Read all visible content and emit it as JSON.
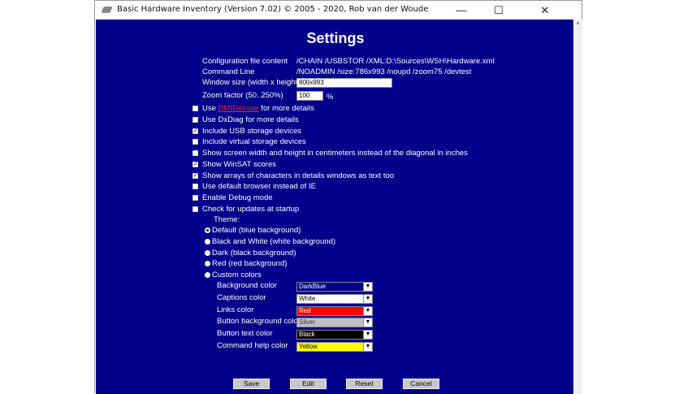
{
  "window": {
    "title": "Basic Hardware Inventory (Version 7.02) © 2005 - 2020, Rob van der Woude",
    "minimize": "—",
    "maximize": "☐",
    "close": "✕"
  },
  "heading": "Settings",
  "info": [
    {
      "label": "Configuration file content",
      "value": "/CHAIN /USBSTOR /XML:D:\\Sources\\WSH\\Hardware.xml"
    },
    {
      "label": "Command Line",
      "value": "/NOADMIN /size:786x993 /noupd /zoom75 /devtest"
    }
  ],
  "window_size": {
    "label": "Window size (width x height)",
    "value": "800x993"
  },
  "zoom": {
    "label": "Zoom factor (50..250%)",
    "value": "100",
    "unit": "%"
  },
  "dmidecode": {
    "pre": "Use ",
    "link": "DMIDecode",
    "post": " for more details",
    "checked": false
  },
  "options": [
    {
      "label": "Use DxDiag for more details",
      "checked": false
    },
    {
      "label": "Include USB storage devices",
      "checked": true
    },
    {
      "label": "Include virtual storage devices",
      "checked": false
    },
    {
      "label": "Show screen width and height in centimeters instead of the diagonal in inches",
      "checked": false
    },
    {
      "label": "Show WinSAT scores",
      "checked": true
    },
    {
      "label": "Show arrays of characters in details windows as text too",
      "checked": true
    },
    {
      "label": "Use default browser instead of IE",
      "checked": false
    },
    {
      "label": "Enable Debug mode",
      "checked": false
    },
    {
      "label": "Check for updates at startup",
      "checked": false
    }
  ],
  "theme": {
    "label": "Theme:",
    "options": [
      "Default (blue background)",
      "Black and White (white background)",
      "Dark (black background)",
      "Red (red background)",
      "Custom colors"
    ],
    "selected": 0
  },
  "colors": [
    {
      "label": "Background color",
      "value": "DarkBlue",
      "bg": "#00008b",
      "fg": "#ffffff"
    },
    {
      "label": "Captions color",
      "value": "White",
      "bg": "#ffffff",
      "fg": "#000000"
    },
    {
      "label": "Links color",
      "value": "Red",
      "bg": "#ff0000",
      "fg": "#ffffff"
    },
    {
      "label": "Button background color",
      "value": "Silver",
      "bg": "#c0c0c0",
      "fg": "#333333"
    },
    {
      "label": "Button text color",
      "value": "Black",
      "bg": "#000000",
      "fg": "#ffffff"
    },
    {
      "label": "Command help color",
      "value": "Yellow",
      "bg": "#ffff00",
      "fg": "#000000"
    }
  ],
  "buttons": {
    "save": "Save",
    "edit": "Edit",
    "reset": "Reset",
    "cancel": "Cancel"
  }
}
